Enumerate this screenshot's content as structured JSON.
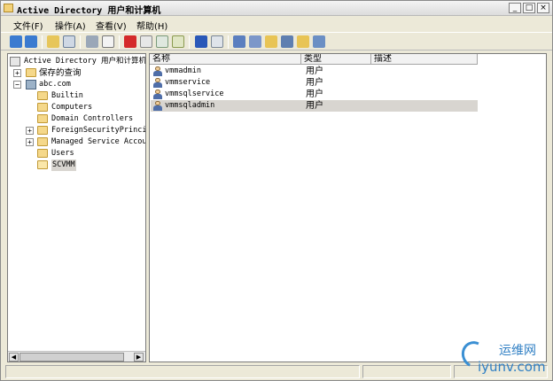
{
  "window": {
    "title": "Active Directory 用户和计算机",
    "minimize": "_",
    "restore": "□",
    "close": "×"
  },
  "menu": {
    "file": "文件(F)",
    "action": "操作(A)",
    "view": "查看(V)",
    "help": "帮助(H)"
  },
  "tree": {
    "root": "Active Directory 用户和计算机",
    "saved_queries": "保存的查询",
    "domain": "abc.com",
    "builtin": "Builtin",
    "computers": "Computers",
    "domain_controllers": "Domain Controllers",
    "foreign_security": "ForeignSecurityPrincip",
    "managed_service": "Managed Service Accour",
    "users": "Users",
    "scvmm": "SCVMM",
    "expand_plus": "+",
    "collapse_minus": "−"
  },
  "list": {
    "columns": [
      "名称",
      "类型",
      "描述"
    ],
    "rows": [
      {
        "name": "vmmadmin",
        "type": "用户"
      },
      {
        "name": "vmmservice",
        "type": "用户"
      },
      {
        "name": "vmmsqlservice",
        "type": "用户"
      },
      {
        "name": "vmmsqladmin",
        "type": "用户"
      }
    ]
  },
  "scroll": {
    "left_arrow": "◀",
    "right_arrow": "▶"
  },
  "watermark": {
    "cn": "运维网",
    "en": "iyunv.com"
  },
  "toolbar": {
    "icons": [
      "back-icon",
      "forward-icon",
      "up-icon",
      "show-hide-tree-icon",
      "cut-icon",
      "copy-icon",
      "delete-icon",
      "properties-icon",
      "refresh-icon",
      "export-icon",
      "help-icon",
      "console-icon",
      "new-user-icon",
      "new-group-icon",
      "new-ou-icon",
      "filter-icon",
      "add-to-group-icon",
      "delegate-icon"
    ]
  },
  "colors": {
    "selected_row": "#d8d5d0",
    "accent_blue": "#2f7fc4"
  }
}
